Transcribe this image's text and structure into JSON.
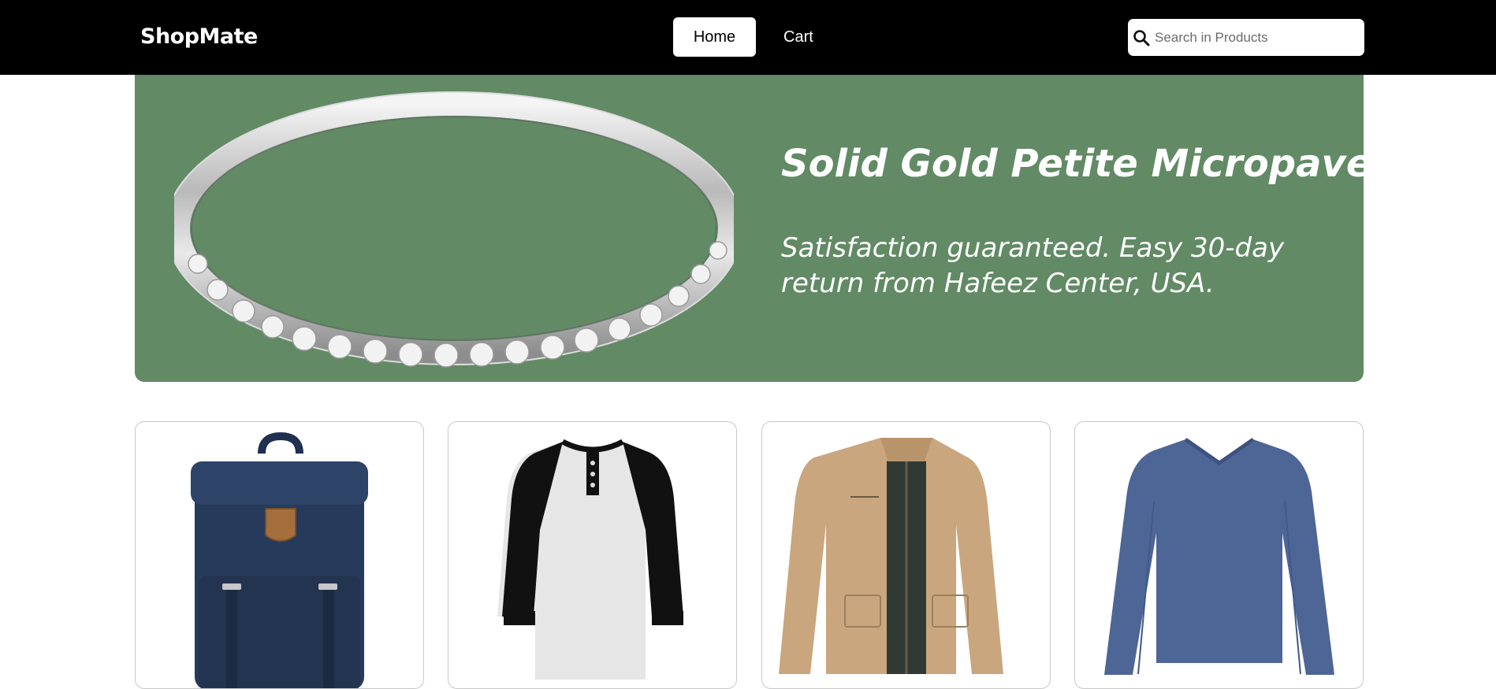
{
  "header": {
    "brand": "ShopMate",
    "nav": [
      {
        "label": "Home",
        "active": true
      },
      {
        "label": "Cart",
        "active": false
      }
    ],
    "search": {
      "placeholder": "Search in Products",
      "value": ""
    }
  },
  "hero": {
    "title": "Solid Gold Petite Micropave",
    "subtitle": "Satisfaction guaranteed. Easy 30-day return from Hafeez Center, USA.",
    "background_color": "#618a65",
    "image_icon": "ring-image"
  },
  "products": [
    {
      "image_icon": "backpack-image"
    },
    {
      "image_icon": "raglan-shirt-image"
    },
    {
      "image_icon": "jacket-image"
    },
    {
      "image_icon": "long-sleeve-shirt-image"
    }
  ],
  "colors": {
    "topbar": "#000000",
    "accent_text": "#ffffff"
  }
}
